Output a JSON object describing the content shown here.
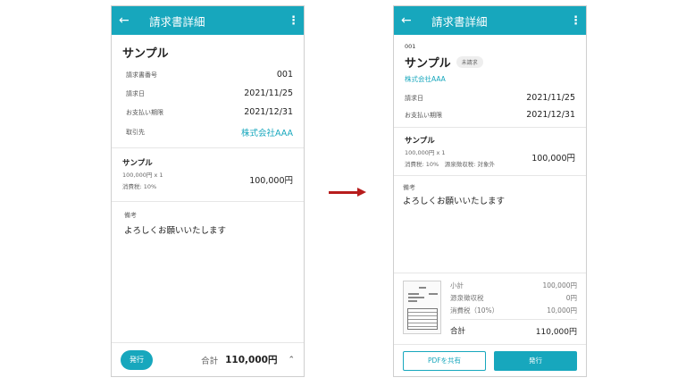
{
  "left": {
    "appbar": {
      "back": "←",
      "title": "請求書詳細",
      "more": "⋮"
    },
    "name": "サンプル",
    "fields": [
      {
        "label": "請求書番号",
        "value": "001"
      },
      {
        "label": "請求日",
        "value": "2021/11/25"
      },
      {
        "label": "お支払い期限",
        "value": "2021/12/31"
      },
      {
        "label": "取引先",
        "value": "株式会社AAA"
      }
    ],
    "item": {
      "name": "サンプル",
      "qty": "100,000円 x 1",
      "tax": "消費税: 10%",
      "price": "100,000円"
    },
    "note": {
      "label": "備考",
      "text": "よろしくお願いいたします"
    },
    "bottom": {
      "issue_label": "発行",
      "total_label": "合計",
      "total_value": "110,000円",
      "chevron": "⌃"
    }
  },
  "right": {
    "appbar": {
      "back": "←",
      "title": "請求書詳細",
      "more": "⋮"
    },
    "number": "001",
    "name": "サンプル",
    "status": "未請求",
    "client": "株式会社AAA",
    "fields": [
      {
        "label": "請求日",
        "value": "2021/11/25"
      },
      {
        "label": "お支払い期限",
        "value": "2021/12/31"
      }
    ],
    "item": {
      "name": "サンプル",
      "qty": "100,000円 x 1",
      "tax": "消費税: 10%　源泉徴収税: 対象外",
      "price": "100,000円"
    },
    "note": {
      "label": "備考",
      "text": "よろしくお願いいたします"
    },
    "summary": [
      {
        "label": "小計",
        "value": "100,000円"
      },
      {
        "label": "源泉徴収税",
        "value": "0円"
      },
      {
        "label": "消費税（10%）",
        "value": "10,000円"
      }
    ],
    "total": {
      "label": "合計",
      "value": "110,000円"
    },
    "actions": {
      "share_label": "PDFを共有",
      "issue_label": "発行"
    }
  },
  "colors": {
    "accent": "#17a7bd",
    "arrow": "#b71c1c"
  }
}
